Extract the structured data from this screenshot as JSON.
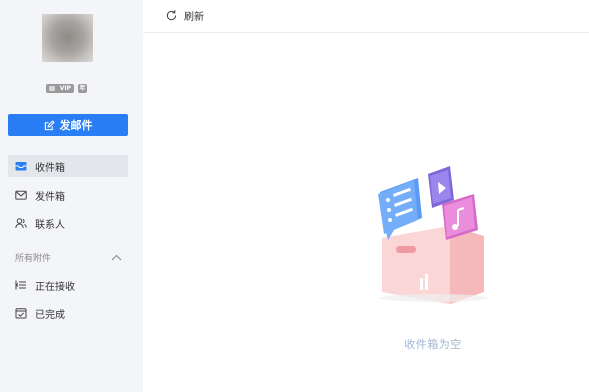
{
  "sidebar": {
    "vip_label": "VIP",
    "level_label": "年",
    "compose_label": "发邮件",
    "items": [
      {
        "label": "收件箱"
      },
      {
        "label": "发件箱"
      },
      {
        "label": "联系人"
      }
    ],
    "section_title": "所有附件",
    "attachment_items": [
      {
        "label": "正在接收"
      },
      {
        "label": "已完成"
      }
    ]
  },
  "toolbar": {
    "refresh_label": "刷新"
  },
  "main": {
    "empty_text": "收件箱为空"
  },
  "colors": {
    "accent": "#2a7ef5",
    "sidebar_bg": "#f4f5f8",
    "empty_text": "#9fb7d3"
  },
  "icons": [
    "edit-icon",
    "inbox-icon",
    "outbox-icon",
    "contacts-icon",
    "chevron-up-icon",
    "receiving-icon",
    "completed-icon",
    "refresh-icon"
  ]
}
